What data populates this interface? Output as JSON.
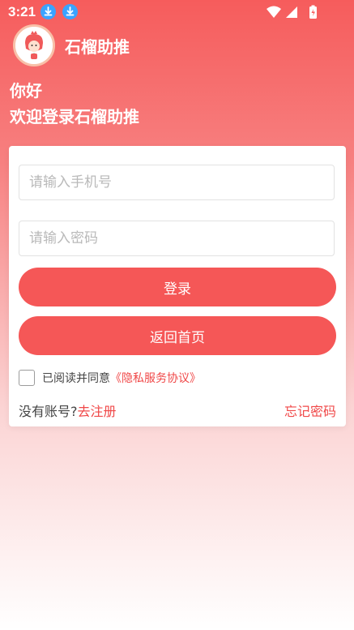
{
  "status_bar": {
    "time": "3:21",
    "icons": [
      "download-icon",
      "download-icon",
      "wifi-icon",
      "signal-icon",
      "battery-icon"
    ]
  },
  "header": {
    "app_name": "石榴助推",
    "greeting": "你好",
    "welcome": "欢迎登录石榴助推"
  },
  "form": {
    "phone_placeholder": "请输入手机号",
    "password_placeholder": "请输入密码",
    "login_label": "登录",
    "back_home_label": "返回首页",
    "agree_text": "已阅读并同意",
    "agreement_link": "《隐私服务协议》",
    "no_account_text": "没有账号?",
    "register_link": "去注册",
    "forgot_password": "忘记密码"
  },
  "colors": {
    "accent": "#f55757",
    "link": "#f04848",
    "download_badge": "#3aa3ff"
  }
}
